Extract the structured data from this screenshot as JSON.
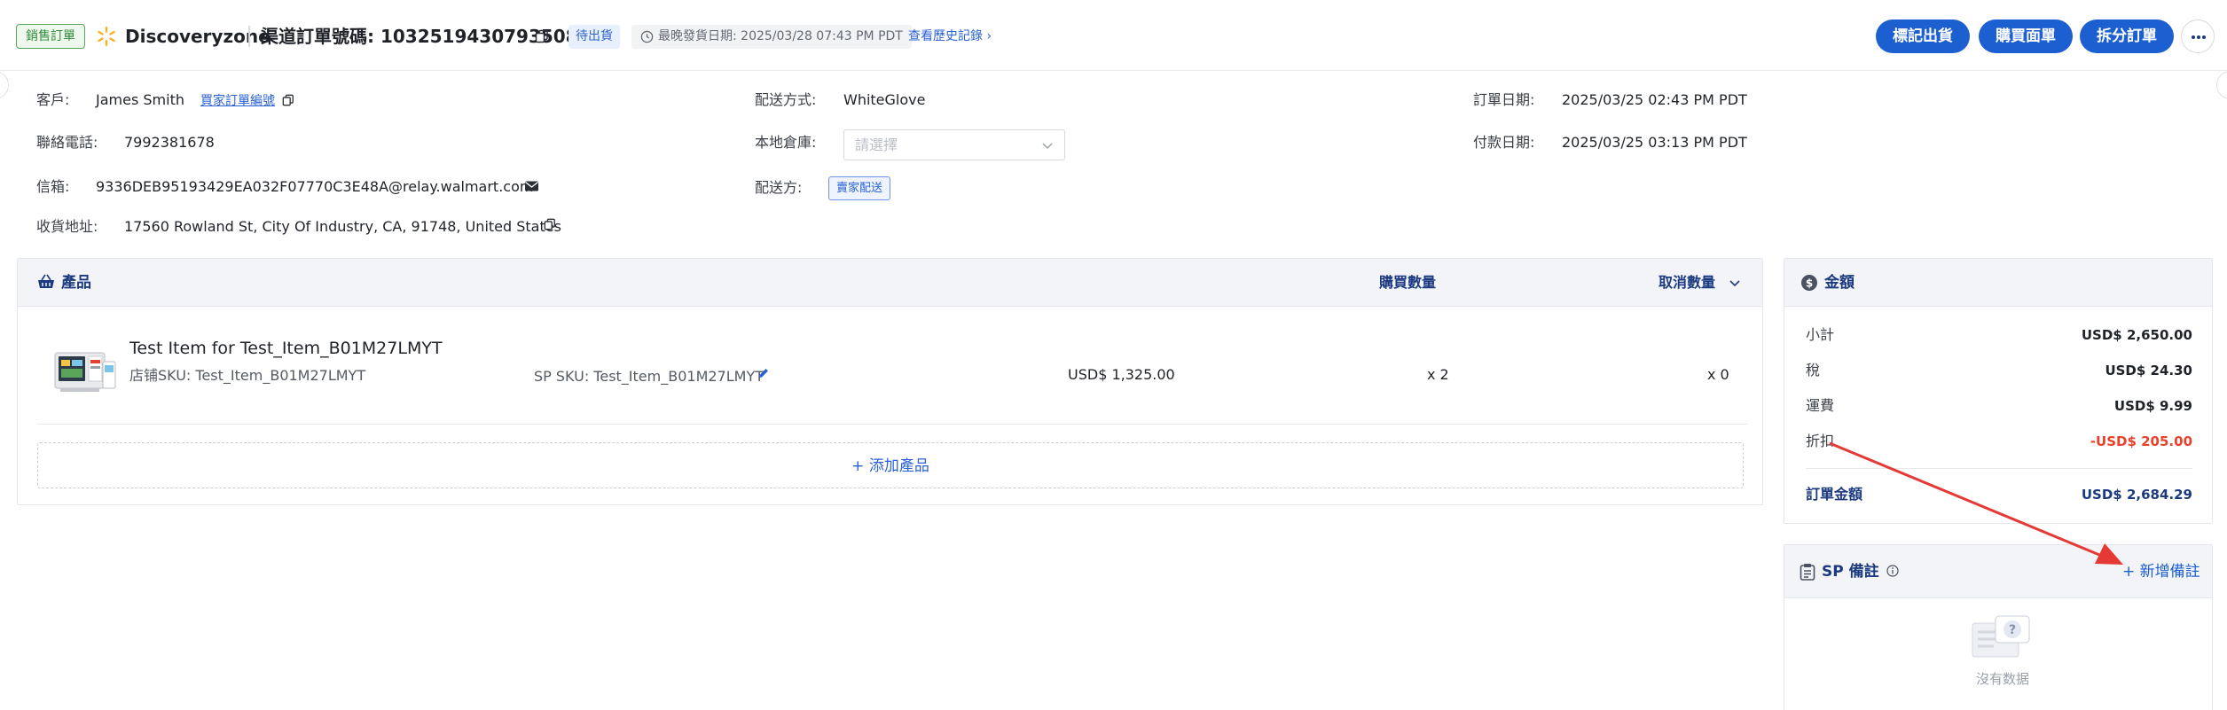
{
  "header": {
    "order_type_tag": "銷售訂單",
    "store_name": "Discoveryzone",
    "order_label": "渠道訂單號碼: 10325194307935088",
    "status": "待出貨",
    "latest_ship_date": "最晚發貨日期:   2025/03/28 07:43 PM PDT",
    "history_link": "查看歷史記錄 ›",
    "buttons": {
      "mark_shipped": "標記出貨",
      "buy_label": "購買面單",
      "split_order": "拆分訂單"
    }
  },
  "customer": {
    "customer_label": "客戶:",
    "customer_name": "James Smith",
    "buyer_order_link": "買家訂單編號",
    "phone_label": "聯絡電話:",
    "phone": "7992381678",
    "email_label": "信箱:",
    "email": "9336DEB95193429EA032F07770C3E48A@relay.walmart.com",
    "address_label": "收貨地址:",
    "address": "17560 Rowland St, City Of Industry, CA, 91748, United States"
  },
  "shipping": {
    "method_label": "配送方式:",
    "method": "WhiteGlove",
    "warehouse_label": "本地倉庫:",
    "warehouse_placeholder": "請選擇",
    "delivery_label": "配送方:",
    "delivery_value": "賣家配送"
  },
  "dates": {
    "order_date_label": "訂單日期:",
    "order_date": "2025/03/25 02:43 PM PDT",
    "payment_date_label": "付款日期:",
    "payment_date": "2025/03/25 03:13 PM PDT"
  },
  "products": {
    "title": "產品",
    "col_purchase_qty": "購買數量",
    "col_cancel_qty": "取消數量",
    "items": [
      {
        "name": "Test Item for Test_Item_B01M27LMYT",
        "store_sku": "店铺SKU: Test_Item_B01M27LMYT",
        "sp_sku": "SP SKU: Test_Item_B01M27LMYT",
        "price": "USD$ 1,325.00",
        "purchase_qty": "x 2",
        "cancel_qty": "x 0"
      }
    ],
    "add_product": "+ 添加產品"
  },
  "amount": {
    "title": "金額",
    "rows": [
      {
        "label": "小計",
        "value": "USD$ 2,650.00"
      },
      {
        "label": "稅",
        "value": "USD$ 24.30"
      },
      {
        "label": "運費",
        "value": "USD$ 9.99"
      },
      {
        "label": "折扣",
        "value": "-USD$ 205.00"
      }
    ],
    "total_label": "訂單金額",
    "total_value": "USD$ 2,684.29",
    "discount_color": "#e8412c"
  },
  "notes": {
    "title": "SP 備註",
    "add_note": "+ 新增備註",
    "empty_text": "沒有数据"
  },
  "colors": {
    "primary": "#1c5fd1",
    "heading": "#1c3a80",
    "annotation_arrow": "#e53935"
  }
}
